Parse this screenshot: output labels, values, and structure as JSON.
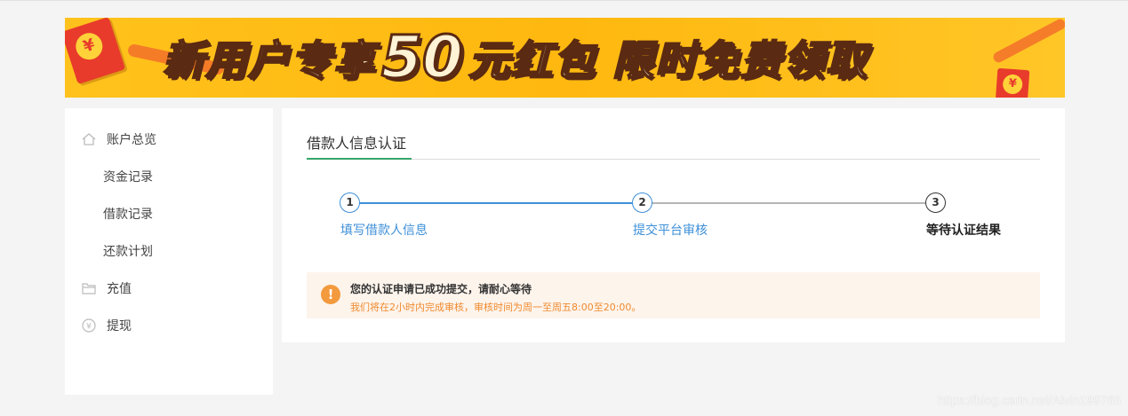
{
  "banner": {
    "slogan_part1": "新用户专享",
    "slogan_number": "50",
    "slogan_part2": "元红包 限时免费领取",
    "coin_symbol": "¥"
  },
  "sidebar": {
    "items": [
      {
        "label": "账户总览",
        "icon": "home-icon"
      },
      {
        "label": "资金记录"
      },
      {
        "label": "借款记录"
      },
      {
        "label": "还款计划"
      },
      {
        "label": "充值",
        "icon": "folder-icon"
      },
      {
        "label": "提现",
        "icon": "yuan-coin-icon"
      }
    ]
  },
  "main": {
    "title": "借款人信息认证",
    "steps": [
      {
        "number": "1",
        "label": "填写借款人信息"
      },
      {
        "number": "2",
        "label": "提交平台审核"
      },
      {
        "number": "3",
        "label": "等待认证结果"
      }
    ],
    "notice": {
      "icon": "!",
      "title": "您的认证申请已成功提交，请耐心等待",
      "description": "我们将在2小时内完成审核，审核时间为周一至周五8:00至20:00。"
    }
  },
  "watermark": "https://blog.csdn.net/Alvin199765",
  "colors": {
    "accent_blue": "#3d8fd8",
    "accent_green": "#35a46b",
    "warning_orange": "#f29a3d",
    "banner_yellow": "#ffc21c"
  }
}
